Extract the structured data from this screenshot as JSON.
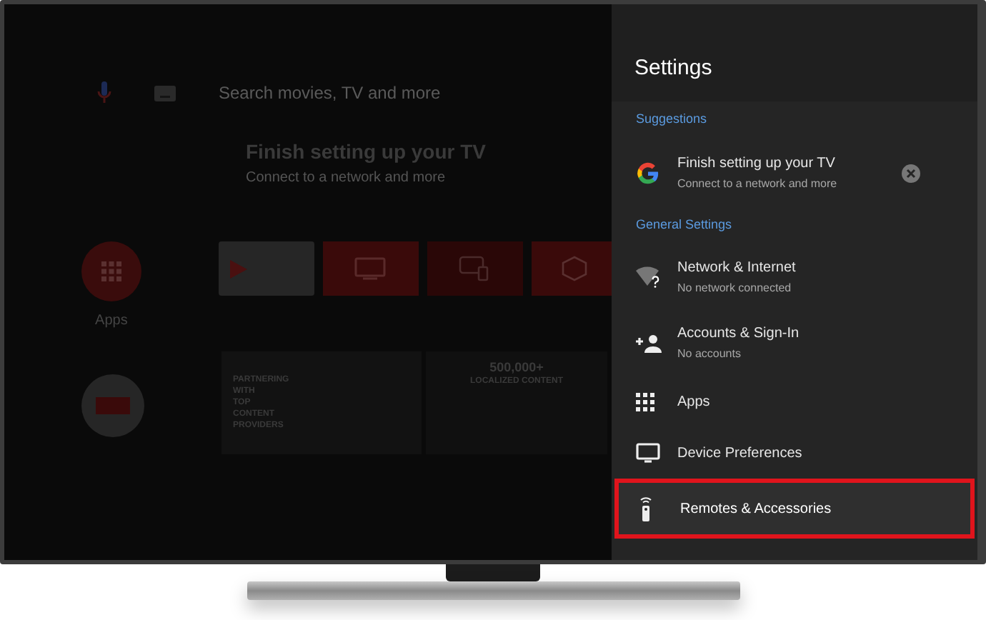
{
  "home": {
    "search": {
      "placeholder": "Search movies, TV and more"
    },
    "banner": {
      "title": "Finish setting up your TV",
      "subtitle": "Connect to a network and more"
    },
    "apps_label": "Apps",
    "promos": [
      {
        "lines": [
          "PARTNERING",
          "WITH",
          "TOP",
          "CONTENT",
          "PROVIDERS"
        ]
      },
      {
        "lines": [
          "500,000+",
          "LOCALIZED CONTENT"
        ]
      }
    ]
  },
  "settings": {
    "title": "Settings",
    "sections": [
      {
        "heading": "Suggestions",
        "items": [
          {
            "kind": "suggestion",
            "title": "Finish setting up your TV",
            "subtitle": "Connect to a network and more",
            "selected": false
          }
        ]
      },
      {
        "heading": "General Settings",
        "items": [
          {
            "kind": "network",
            "title": "Network & Internet",
            "subtitle": "No network connected",
            "selected": false
          },
          {
            "kind": "account",
            "title": "Accounts & Sign-In",
            "subtitle": "No accounts",
            "selected": false
          },
          {
            "kind": "apps",
            "title": "Apps",
            "selected": false
          },
          {
            "kind": "display",
            "title": "Device Preferences",
            "selected": false
          },
          {
            "kind": "remote",
            "title": "Remotes & Accessories",
            "selected": true
          }
        ]
      }
    ]
  }
}
